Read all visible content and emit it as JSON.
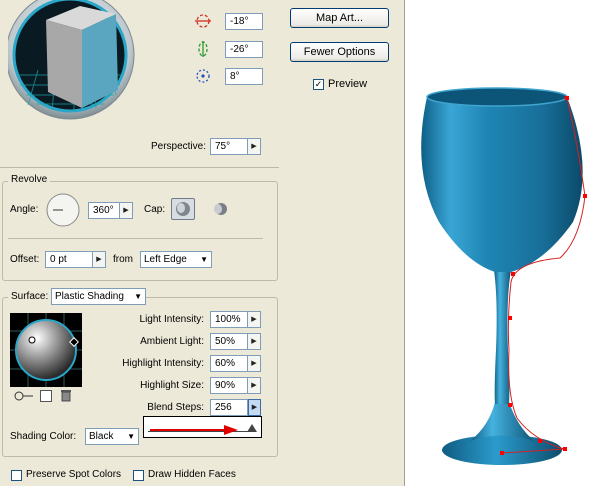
{
  "rotation": {
    "x_angle": "-18°",
    "y_angle": "-26°",
    "z_angle": "8°",
    "perspective_label": "Perspective:",
    "perspective_value": "75°"
  },
  "buttons": {
    "map_art": "Map Art...",
    "fewer_options": "Fewer Options"
  },
  "preview": {
    "label": "Preview",
    "checked": true
  },
  "revolve": {
    "title": "Revolve",
    "angle_label": "Angle:",
    "angle_value": "360°",
    "cap_label": "Cap:",
    "offset_label": "Offset:",
    "offset_value": "0 pt",
    "from_label": "from",
    "from_value": "Left Edge"
  },
  "surface": {
    "label": "Surface:",
    "value": "Plastic Shading",
    "light_intensity_label": "Light Intensity:",
    "light_intensity_value": "100%",
    "ambient_light_label": "Ambient Light:",
    "ambient_light_value": "50%",
    "highlight_intensity_label": "Highlight Intensity:",
    "highlight_intensity_value": "60%",
    "highlight_size_label": "Highlight Size:",
    "highlight_size_value": "90%",
    "blend_steps_label": "Blend Steps:",
    "blend_steps_value": "256",
    "blend_steps_slider": 1.0,
    "shading_color_label": "Shading Color:",
    "shading_color_value": "Black"
  },
  "footer": {
    "preserve_spot_colors": "Preserve Spot Colors",
    "draw_hidden_faces": "Draw Hidden Faces"
  },
  "colors": {
    "panel_bg": "#ece9d8",
    "glass_blue": "#1f86b5",
    "anchor_red": "#ff0000",
    "arrow_red": "#e00000"
  },
  "icons": {
    "x_axis": "x-rotation-icon",
    "y_axis": "y-rotation-icon",
    "z_axis": "z-rotation-icon"
  }
}
